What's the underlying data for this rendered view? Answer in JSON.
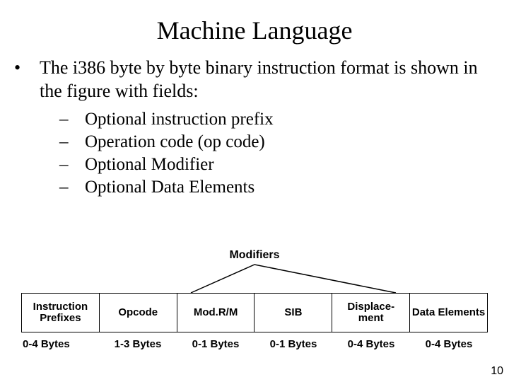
{
  "title": "Machine Language",
  "bullet": "The i386 byte by byte binary instruction format is shown in the figure with fields:",
  "subitems": [
    "Optional instruction prefix",
    "Operation code (op code)",
    "Optional Modifier",
    "Optional Data Elements"
  ],
  "diagram": {
    "modifiers_label": "Modifiers",
    "boxes": [
      {
        "label": "Instruction Prefixes",
        "range": "0-4 Bytes"
      },
      {
        "label": "Opcode",
        "range": "1-3 Bytes"
      },
      {
        "label": "Mod.R/M",
        "range": "0-1 Bytes"
      },
      {
        "label": "SIB",
        "range": "0-1 Bytes"
      },
      {
        "label": "Displace-\nment",
        "range": "0-4 Bytes"
      },
      {
        "label": "Data Elements",
        "range": "0-4 Bytes"
      }
    ]
  },
  "page_number": "10"
}
